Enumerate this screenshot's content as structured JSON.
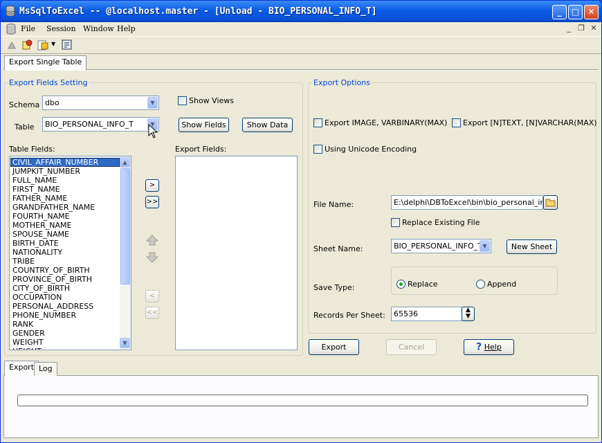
{
  "window": {
    "title": "MsSqlToExcel -- @localhost.master - [Unload - BIO_PERSONAL_INFO_T]",
    "minimize_icon": "minimize-icon",
    "maximize_icon": "maximize-icon",
    "close_icon": "close-icon"
  },
  "menu": {
    "items": [
      {
        "label": "File"
      },
      {
        "label": "Session"
      },
      {
        "label": "Window"
      },
      {
        "label": "Help"
      }
    ]
  },
  "tabs": {
    "top": [
      {
        "label": "Export Single Table"
      }
    ],
    "bottom": [
      {
        "label": "Export"
      },
      {
        "label": "Log"
      }
    ]
  },
  "fields_setting": {
    "group_label": "Export Fields Setting",
    "schema_label": "Schema",
    "schema_value": "dbo",
    "show_views_label": "Show Views",
    "show_views_checked": false,
    "table_label": "Table",
    "table_value": "BIO_PERSONAL_INFO_T",
    "show_fields_label": "Show Fields",
    "show_data_label": "Show Data",
    "table_fields_label": "Table Fields:",
    "export_fields_label": "Export Fields:",
    "table_fields": [
      "CIVIL_AFFAIR_NUMBER",
      "JUMPKIT_NUMBER",
      "FULL_NAME",
      "FIRST_NAME",
      "FATHER_NAME",
      "GRANDFATHER_NAME",
      "FOURTH_NAME",
      "MOTHER_NAME",
      "SPOUSE_NAME",
      "BIRTH_DATE",
      "NATIONALITY",
      "TRIBE",
      "COUNTRY_OF_BIRTH",
      "PROVINCE_OF_BIRTH",
      "CITY_OF_BIRTH",
      "OCCUPATION",
      "PERSONAL_ADDRESS",
      "PHONE_NUMBER",
      "RANK",
      "GENDER",
      "WEIGHT",
      "HEIGHT"
    ],
    "selected_field": "CIVIL_AFFAIR_NUMBER",
    "export_fields": [],
    "move_one": ">",
    "move_all": ">>",
    "remove_one": "<",
    "remove_all": "<<"
  },
  "export_options": {
    "group_label": "Export Options",
    "export_image_label": "Export IMAGE, VARBINARY(MAX)",
    "export_ntext_label": "Export [N]TEXT, [N]VARCHAR(MAX)",
    "unicode_label": "Using Unicode Encoding",
    "file_name_label": "File Name:",
    "file_name_value": "E:\\delphi\\DBToExcel\\bin\\bio_personal_info_",
    "replace_existing_label": "Replace Existing File",
    "sheet_name_label": "Sheet Name:",
    "sheet_name_value": "BIO_PERSONAL_INFO_T",
    "new_sheet_label": "New Sheet",
    "save_type_label": "Save Type:",
    "replace_label": "Replace",
    "append_label": "Append",
    "save_type_selected": "Replace",
    "records_label": "Records Per Sheet:",
    "records_value": "65536"
  },
  "actions": {
    "export_label": "Export",
    "cancel_label": "Cancel",
    "help_label": "Help"
  },
  "progress": {
    "value": 0
  }
}
